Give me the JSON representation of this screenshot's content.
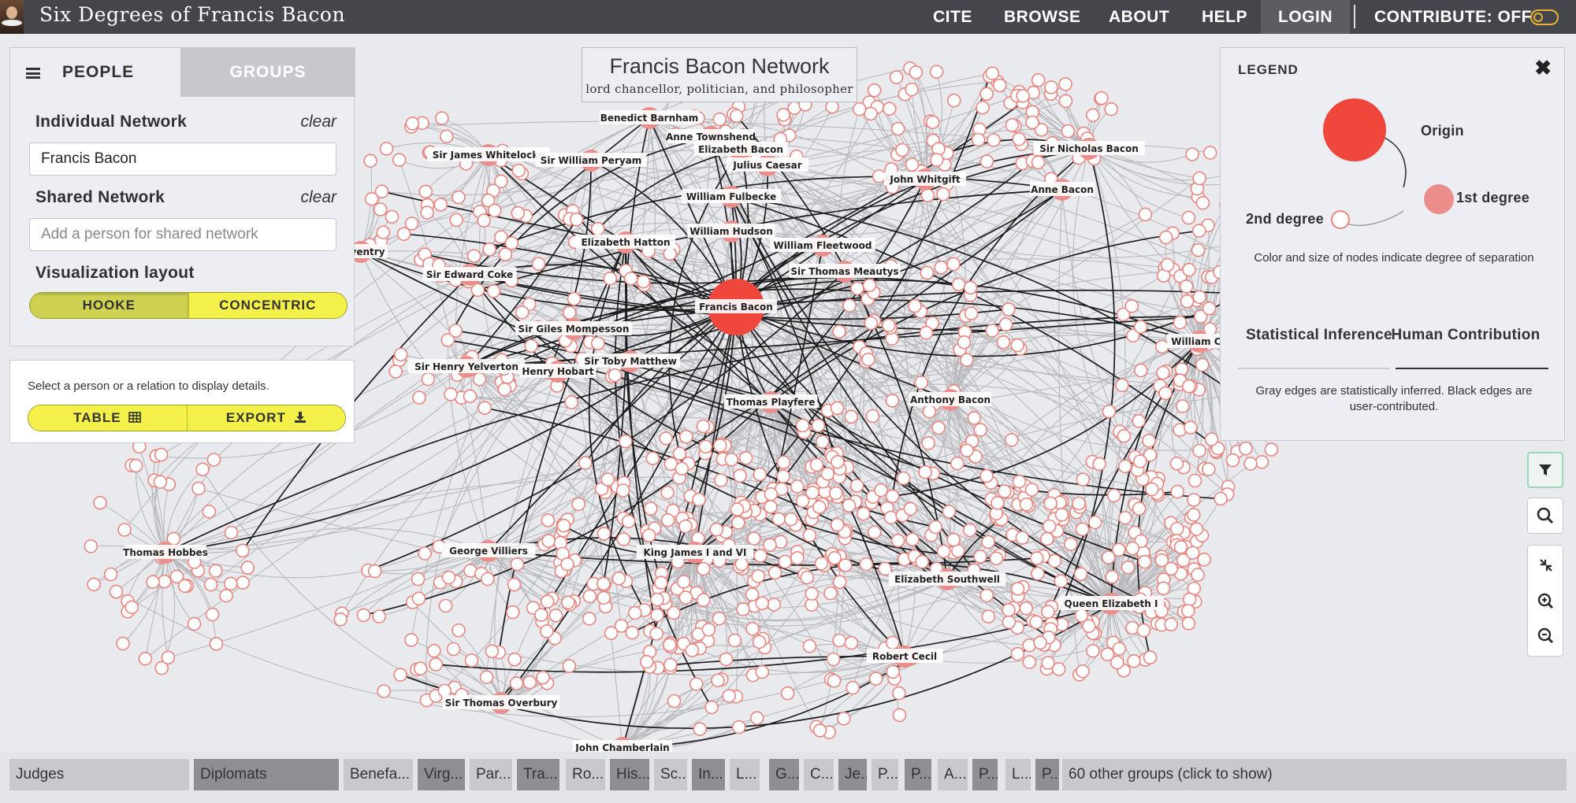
{
  "app": {
    "title": "Six Degrees of Francis Bacon"
  },
  "nav": {
    "cite": "CITE",
    "browse": "BROWSE",
    "about": "ABOUT",
    "help": "HELP",
    "login": "LOGIN",
    "contribute": "CONTRIBUTE: OFF"
  },
  "sidebar": {
    "tabs": {
      "people": "PEOPLE",
      "groups": "GROUPS"
    },
    "individual_label": "Individual Network",
    "clear": "clear",
    "individual_value": "Francis Bacon",
    "shared_label": "Shared Network",
    "shared_placeholder": "Add a person for shared network",
    "layout_label": "Visualization layout",
    "layout_hooke": "HOOKE",
    "layout_concentric": "CONCENTRIC",
    "details_text": "Select a person or a relation to display details.",
    "table_button": "TABLE",
    "export_button": "EXPORT"
  },
  "network_title": {
    "name": "Francis Bacon Network",
    "subtitle": "lord chancellor, politician, and philosopher"
  },
  "legend": {
    "title": "LEGEND",
    "close": "✖",
    "origin": "Origin",
    "first_degree": "1st degree",
    "second_degree": "2nd degree",
    "note": "Color and size of nodes indicate degree of separation",
    "tab_statistical": "Statistical Inference",
    "tab_human": "Human Contribution",
    "edges_note": "Gray edges are statistically inferred. Black edges are user-contributed.",
    "colors": {
      "origin": "#f0473c",
      "first": "#eb8d8a",
      "second_fill": "#fff",
      "second_stroke": "#e8867f"
    }
  },
  "graph": {
    "people": [
      "Francis Bacon",
      "Benedict Barnham",
      "Anne Townshend",
      "Elizabeth Bacon",
      "Julius Caesar",
      "Sir James Whitelocke",
      "Sir William Peryam",
      "William Fulbecke",
      "William Hudson",
      "Elizabeth Hatton",
      "William Fleetwood",
      "Coventry",
      "Sir Edward Coke",
      "Sir Thomas Meautys",
      "John Whitgift",
      "Sir Nicholas Bacon",
      "Anne Bacon",
      "Sir Giles Mompesson",
      "Sir Henry Yelverton",
      "Henry Hobart",
      "Sir Toby Matthew",
      "Thomas Playfere",
      "Anthony Bacon",
      "William Ce",
      "Thomas Hobbes",
      "George Villiers",
      "King James I and VI",
      "Elizabeth Southwell",
      "Queen Elizabeth I",
      "Robert Cecil",
      "Sir Thomas Overbury",
      "John Chamberlain"
    ]
  },
  "groups_bar": {
    "chips": [
      "Judges",
      "Diplomats",
      "Benefa...",
      "Virg...",
      "Par...",
      "Tra...",
      "Ro...",
      "His...",
      "Sc...",
      "In...",
      "L...",
      "G...",
      "C...",
      "Je...",
      "P...",
      "P...",
      "A...",
      "P...",
      "L...",
      "P..."
    ],
    "more": "60 other groups (click to show)"
  },
  "icons": [
    "menu-icon",
    "table-icon",
    "download-icon",
    "close-icon",
    "filter-icon",
    "search-icon",
    "collapse-icon",
    "zoom-in-icon",
    "zoom-out-icon"
  ]
}
